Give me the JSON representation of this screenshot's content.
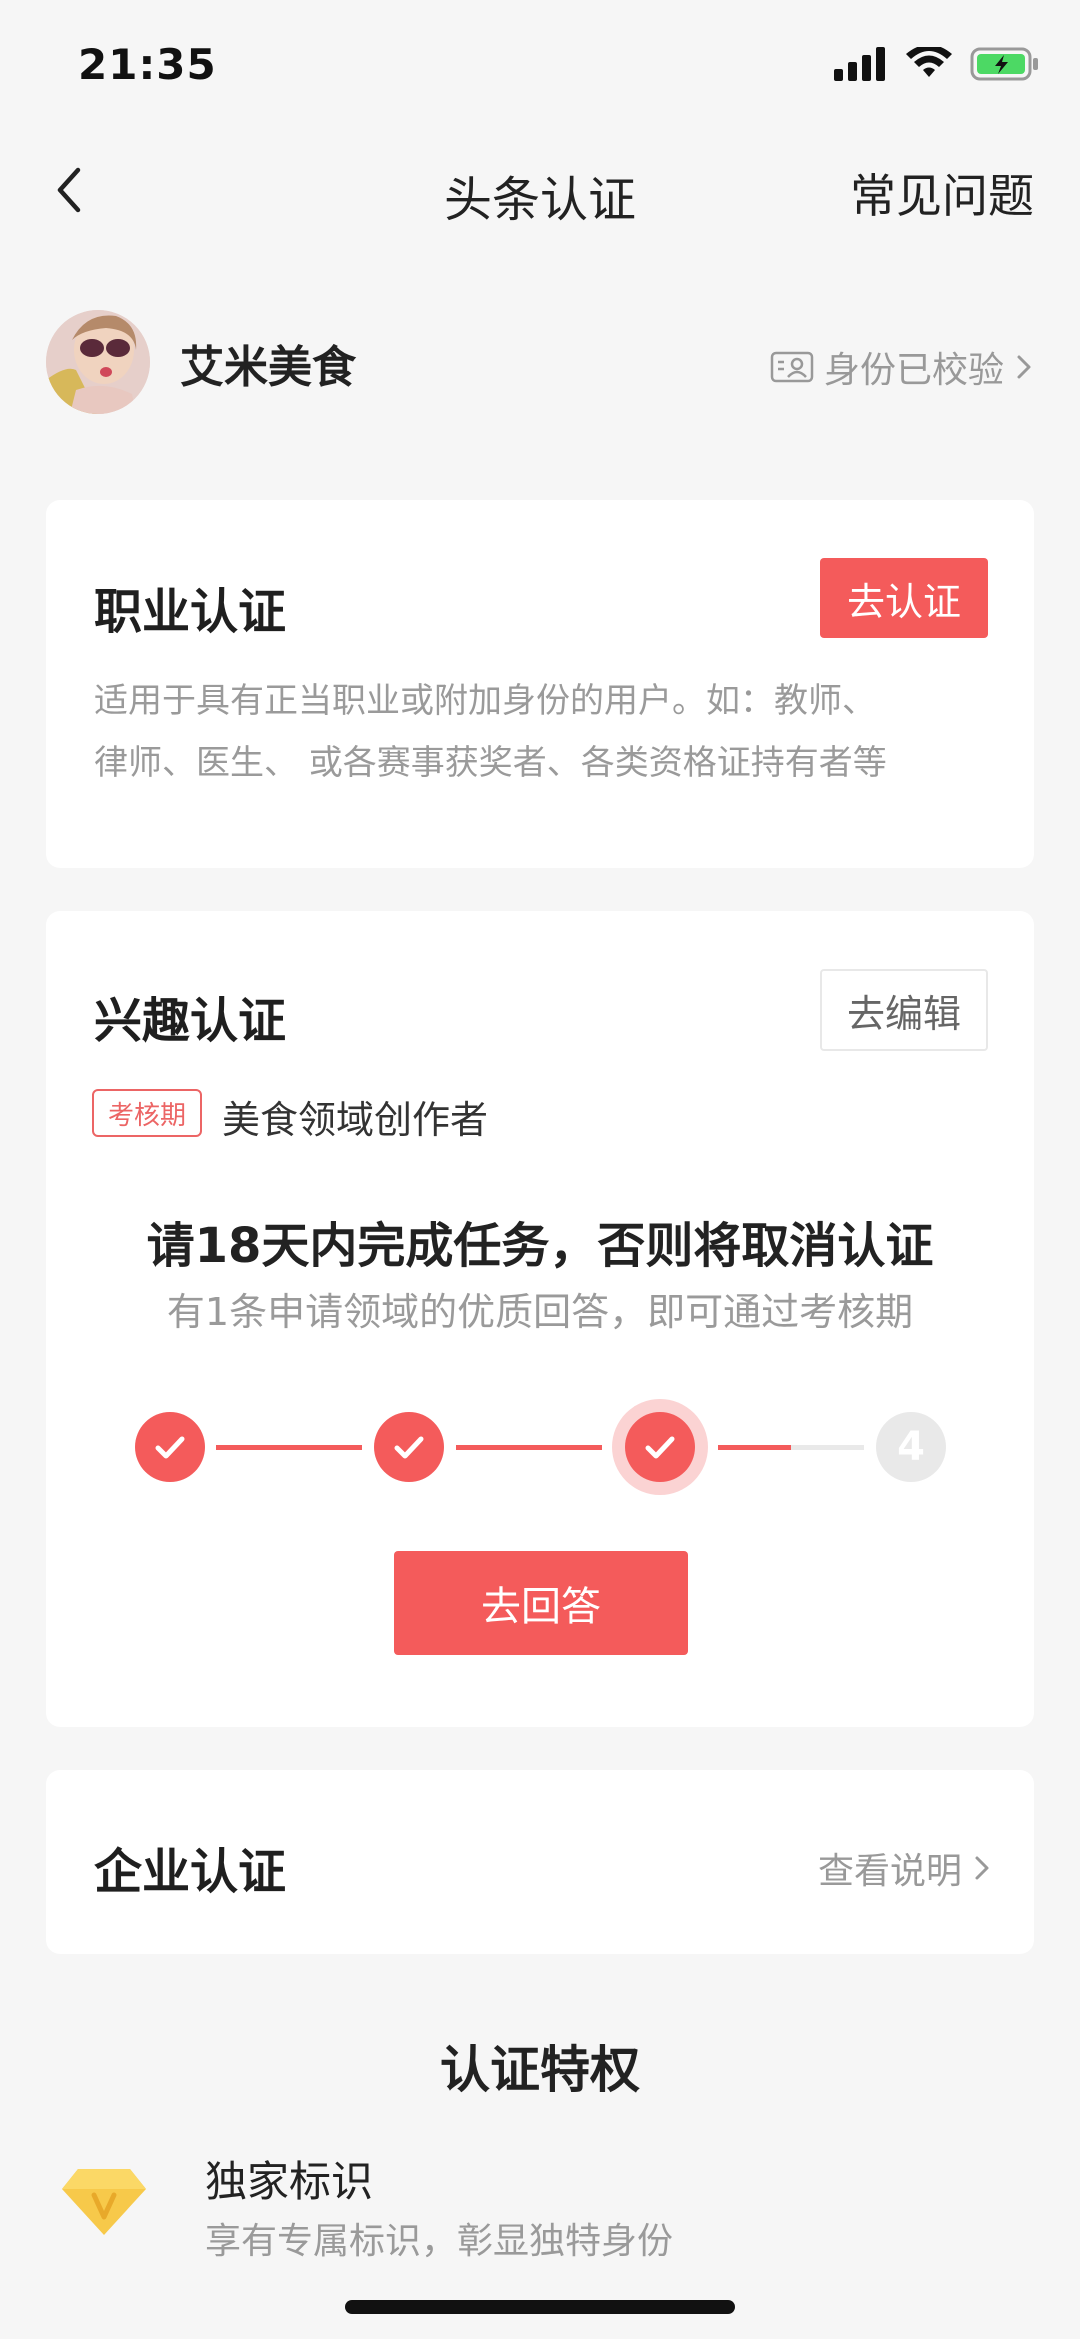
{
  "status": {
    "time": "21:35"
  },
  "nav": {
    "title": "头条认证",
    "faq": "常见问题"
  },
  "profile": {
    "name": "艾米美食",
    "verified_text": "身份已校验"
  },
  "career": {
    "title": "职业认证",
    "button": "去认证",
    "desc_line1": "适用于具有正当职业或附加身份的用户。如：教师、",
    "desc_line2": "律师、医生、 或各赛事获奖者、各类资格证持有者等"
  },
  "interest": {
    "title": "兴趣认证",
    "button": "去编辑",
    "badge": "考核期",
    "field": "美食领域创作者",
    "warning": "请18天内完成任务，否则将取消认证",
    "subtext": "有1条申请领域的优质回答，即可通过考核期",
    "steps_completed": 3,
    "steps_total": 4,
    "pending_step_label": "4",
    "action": "去回答"
  },
  "enterprise": {
    "title": "企业认证",
    "link": "查看说明"
  },
  "privileges": {
    "title": "认证特权",
    "items": [
      {
        "title": "独家标识",
        "desc": "享有专属标识，彰显独特身份",
        "icon": "diamond-v-icon"
      }
    ]
  },
  "colors": {
    "accent": "#f45b5b",
    "background": "#f6f6f6",
    "muted": "#9a9a9a"
  }
}
